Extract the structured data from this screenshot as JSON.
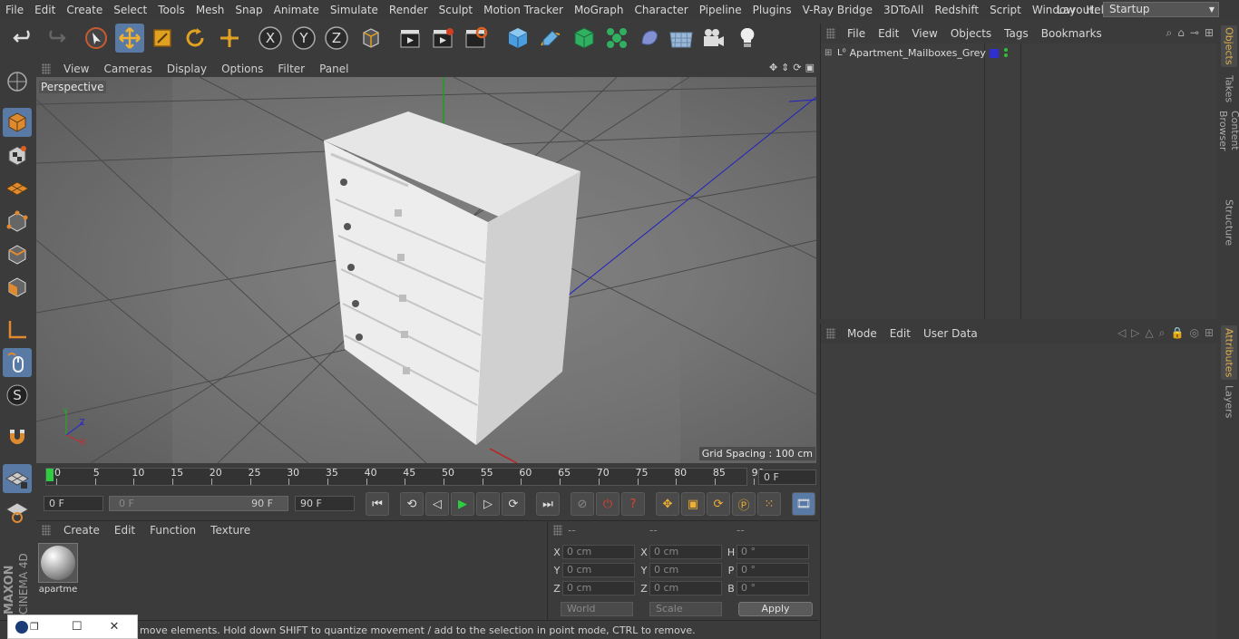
{
  "menubar": {
    "items": [
      "File",
      "Edit",
      "Create",
      "Select",
      "Tools",
      "Mesh",
      "Snap",
      "Animate",
      "Simulate",
      "Render",
      "Sculpt",
      "Motion Tracker",
      "MoGraph",
      "Character",
      "Pipeline",
      "Plugins",
      "V-Ray Bridge",
      "3DToAll",
      "Redshift",
      "Script",
      "Window",
      "Help"
    ],
    "layout_label": "Layout:",
    "layout_value": "Startup"
  },
  "toolbar": {
    "icons": [
      "undo-icon",
      "redo-icon",
      "select-icon",
      "move-icon",
      "scale-icon",
      "rotate-icon",
      "live-transform-icon",
      "x-axis-icon",
      "y-axis-icon",
      "z-axis-icon",
      "world-coords-icon",
      "render-view-icon",
      "render-picture-viewer-icon",
      "render-settings-icon",
      "cube-icon",
      "pen-icon",
      "subdivision-icon",
      "cloner-icon",
      "deformer-icon",
      "floor-icon",
      "camera-icon",
      "light-icon"
    ],
    "axis_labels": [
      "X",
      "Y",
      "Z"
    ]
  },
  "viewport": {
    "menu": [
      "View",
      "Cameras",
      "Display",
      "Options",
      "Filter",
      "Panel"
    ],
    "label": "Perspective",
    "grid_spacing": "Grid Spacing : 100 cm"
  },
  "timeline": {
    "ticks": [
      "0",
      "5",
      "10",
      "15",
      "20",
      "25",
      "30",
      "35",
      "40",
      "45",
      "50",
      "55",
      "60",
      "65",
      "70",
      "75",
      "80",
      "85",
      "90"
    ],
    "current_frame": "0 F",
    "start_field": "0 F",
    "range_start": "0 F",
    "range_end": "90 F",
    "end_field": "90 F"
  },
  "materials": {
    "menu": [
      "Create",
      "Edit",
      "Function",
      "Texture"
    ],
    "items": [
      {
        "name": "apartme"
      }
    ]
  },
  "coordinates": {
    "header": [
      "--",
      "--",
      "--"
    ],
    "rows": [
      {
        "l1": "X",
        "v1": "0 cm",
        "l2": "X",
        "v2": "0 cm",
        "l3": "H",
        "v3": "0 °"
      },
      {
        "l1": "Y",
        "v1": "0 cm",
        "l2": "Y",
        "v2": "0 cm",
        "l3": "P",
        "v3": "0 °"
      },
      {
        "l1": "Z",
        "v1": "0 cm",
        "l2": "Z",
        "v2": "0 cm",
        "l3": "B",
        "v3": "0 °"
      }
    ],
    "mode_select": "World",
    "scale_select": "Scale",
    "apply_label": "Apply"
  },
  "status": {
    "text": "move elements. Hold down SHIFT to quantize movement / add to the selection in point mode, CTRL to remove."
  },
  "objects": {
    "menu": [
      "File",
      "Edit",
      "View",
      "Objects",
      "Tags",
      "Bookmarks"
    ],
    "items": [
      {
        "name": "Apartment_Mailboxes_Grey"
      }
    ]
  },
  "attributes": {
    "menu": [
      "Mode",
      "Edit",
      "User Data"
    ]
  },
  "side_tabs": {
    "top": [
      "Objects",
      "Takes",
      "Content Browser",
      "Structure"
    ],
    "bottom": [
      "Attributes",
      "Layers"
    ]
  },
  "brand": {
    "line1": "MAXON",
    "line2": "CINEMA 4D"
  },
  "colors": {
    "selected": "#5a7aa6",
    "panel": "#3b3b3b",
    "viewport_bg": "#6e6e6e",
    "accent_tab": "#e0b050"
  }
}
